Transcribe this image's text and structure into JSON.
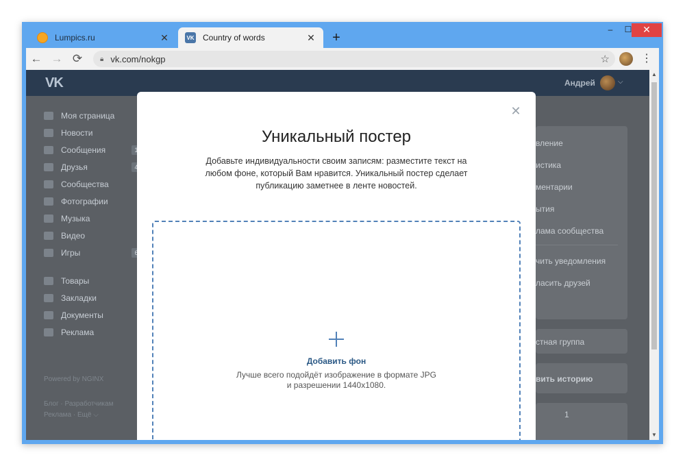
{
  "browser": {
    "tabs": [
      {
        "title": "Lumpics.ru",
        "icon": "lumpics-favicon",
        "active": false
      },
      {
        "title": "Country of words",
        "icon": "vk-favicon",
        "active": true
      }
    ],
    "new_tab": "+",
    "window_controls": {
      "minimize": "–",
      "maximize": "☐",
      "close": "✕"
    },
    "url": "vk.com/nokgp",
    "accent": "#5fa7ef"
  },
  "vk": {
    "logo": "VK",
    "user_name": "Андрей",
    "sidebar": [
      {
        "label": "Моя страница",
        "count": ""
      },
      {
        "label": "Новости",
        "count": ""
      },
      {
        "label": "Сообщения",
        "count": "1"
      },
      {
        "label": "Друзья",
        "count": "4"
      },
      {
        "label": "Сообщества",
        "count": ""
      },
      {
        "label": "Фотографии",
        "count": ""
      },
      {
        "label": "Музыка",
        "count": ""
      },
      {
        "label": "Видео",
        "count": ""
      },
      {
        "label": "Игры",
        "count": "6"
      }
    ],
    "sidebar2": [
      {
        "label": "Товары"
      },
      {
        "label": "Закладки"
      },
      {
        "label": "Документы"
      },
      {
        "label": "Реклама"
      }
    ],
    "powered": "Powered by NGINX",
    "footer_line1": "Блог · Разработчикам",
    "footer_line2": "Реклама · Ещё ⌵",
    "right_menu": [
      "вление",
      "истика",
      "ментарии",
      "ытия",
      "лама сообщества",
      "чить уведомления",
      "ласить друзей"
    ],
    "right_group": "стная группа",
    "right_story": "вить историю",
    "right_count": "1"
  },
  "modal": {
    "title": "Уникальный постер",
    "description": "Добавьте индивидуальности своим записям: разместите текст на любом фоне, который Вам нравится. Уникальный постер сделает публикацию заметнее в ленте новостей.",
    "add_background": "Добавить фон",
    "hint_line1": "Лучше всего подойдёт изображение в формате JPG",
    "hint_line2": "и разрешении 1440x1080.",
    "close": "✕",
    "accent": "#5181b8"
  }
}
